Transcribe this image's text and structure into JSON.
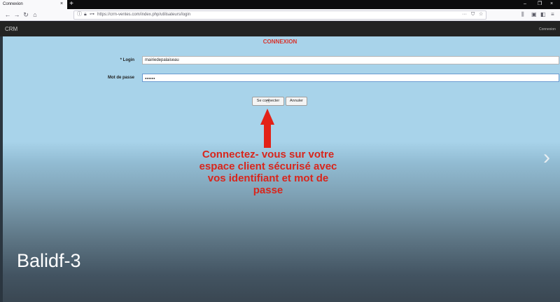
{
  "browser": {
    "tab_title": "Connexion",
    "url": "https://crm-ventes.com/index.php/utilisateurs/login"
  },
  "site": {
    "brand": "CRM",
    "nav_link": "Connexion"
  },
  "form": {
    "title": "CONNEXION",
    "login_label": "* Login",
    "login_value": "mairiedepalaiseau",
    "password_label": "Mot de passe",
    "password_value": "●●●●●●",
    "submit_label": "Se connecter",
    "cancel_label": "Annuler"
  },
  "overlay": {
    "callout": "Connectez- vous sur votre espace client sécurisé avec vos identifiant et mot de passe",
    "watermark": "Balidf-3"
  },
  "colors": {
    "accent_red": "#e32117",
    "page_bg": "#a8d3ea",
    "site_bar": "#232323"
  }
}
